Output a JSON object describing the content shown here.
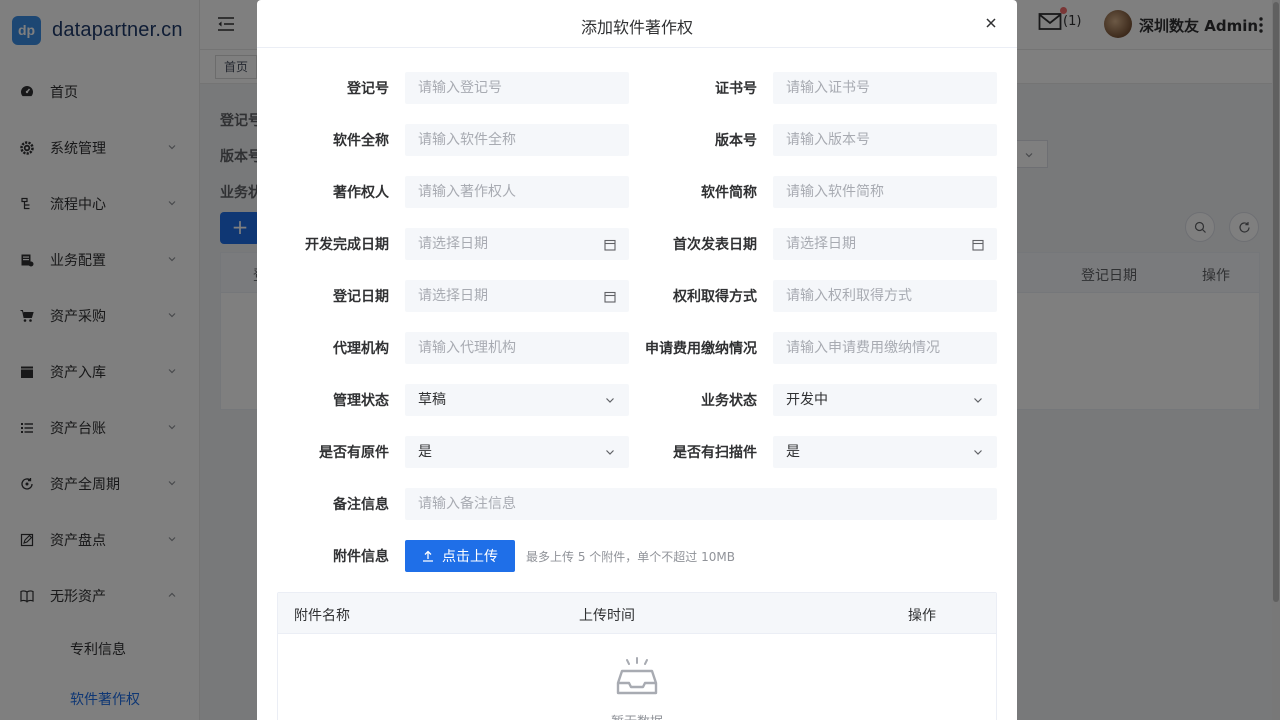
{
  "app": {
    "logo_mark": "dp",
    "logo_text": "datapartner.cn",
    "menu": [
      {
        "label": "首页",
        "icon": "dashboard-icon"
      },
      {
        "label": "系统管理",
        "icon": "gear-icon"
      },
      {
        "label": "流程中心",
        "icon": "flow-icon"
      },
      {
        "label": "业务配置",
        "icon": "config-icon"
      },
      {
        "label": "资产采购",
        "icon": "cart-icon"
      },
      {
        "label": "资产入库",
        "icon": "clapper-icon"
      },
      {
        "label": "资产台账",
        "icon": "list-icon"
      },
      {
        "label": "资产全周期",
        "icon": "cycle-icon"
      },
      {
        "label": "资产盘点",
        "icon": "edit-icon"
      },
      {
        "label": "无形资产",
        "icon": "book-icon"
      }
    ],
    "submenu": [
      {
        "label": "专利信息"
      },
      {
        "label": "软件著作权",
        "active": true
      }
    ],
    "header": {
      "mail_count": "(1)",
      "user": "深圳数友 Admin"
    },
    "tags": [
      "首页"
    ],
    "background": {
      "labels": [
        "登记号",
        "版本号",
        "业务状"
      ],
      "add_label": "+",
      "table_headers": [
        "登",
        "登记日期",
        "操作"
      ]
    }
  },
  "dialog": {
    "title": "添加软件著作权",
    "fields": {
      "reg_no": {
        "label": "登记号",
        "placeholder": "请输入登记号"
      },
      "cert_no": {
        "label": "证书号",
        "placeholder": "请输入证书号"
      },
      "full_name": {
        "label": "软件全称",
        "placeholder": "请输入软件全称"
      },
      "version": {
        "label": "版本号",
        "placeholder": "请输入版本号"
      },
      "owner": {
        "label": "著作权人",
        "placeholder": "请输入著作权人"
      },
      "short_name": {
        "label": "软件简称",
        "placeholder": "请输入软件简称"
      },
      "dev_date": {
        "label": "开发完成日期",
        "placeholder": "请选择日期"
      },
      "pub_date": {
        "label": "首次发表日期",
        "placeholder": "请选择日期"
      },
      "reg_date": {
        "label": "登记日期",
        "placeholder": "请选择日期"
      },
      "acquire": {
        "label": "权利取得方式",
        "placeholder": "请输入权利取得方式"
      },
      "agency": {
        "label": "代理机构",
        "placeholder": "请输入代理机构"
      },
      "fee": {
        "label": "申请费用缴纳情况",
        "placeholder": "请输入申请费用缴纳情况"
      },
      "mgmt_status": {
        "label": "管理状态",
        "value": "草稿"
      },
      "biz_status": {
        "label": "业务状态",
        "value": "开发中"
      },
      "has_original": {
        "label": "是否有原件",
        "value": "是"
      },
      "has_scan": {
        "label": "是否有扫描件",
        "value": "是"
      },
      "remark": {
        "label": "备注信息",
        "placeholder": "请输入备注信息"
      },
      "attachment": {
        "label": "附件信息"
      }
    },
    "upload": {
      "button": "点击上传",
      "tip": "最多上传 5 个附件，单个不超过 10MB"
    },
    "attachments_table": {
      "headers": [
        "附件名称",
        "上传时间",
        "操作"
      ],
      "empty_text": "暂无数据"
    }
  }
}
